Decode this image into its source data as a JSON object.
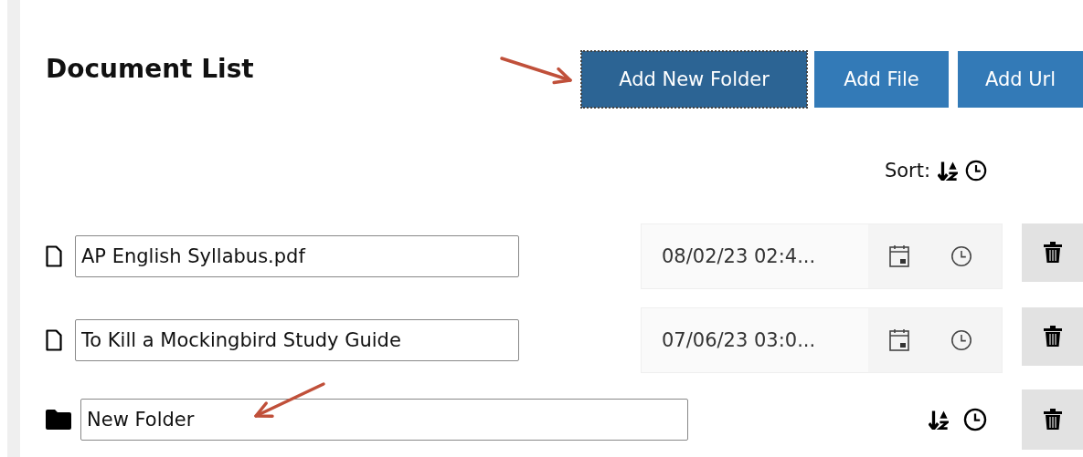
{
  "title": "Document List",
  "buttons": [
    {
      "label": "Add New Folder",
      "focused": true
    },
    {
      "label": "Add File",
      "focused": false
    },
    {
      "label": "Add Url",
      "focused": false
    }
  ],
  "sort": {
    "label": "Sort:"
  },
  "items": [
    {
      "kind": "file",
      "name": "AP English Syllabus.pdf",
      "date": "08/02/23 02:4..."
    },
    {
      "kind": "file",
      "name": "To Kill a Mockingbird Study Guide",
      "date": "07/06/23 03:0..."
    },
    {
      "kind": "folder",
      "name": "New Folder"
    }
  ]
}
